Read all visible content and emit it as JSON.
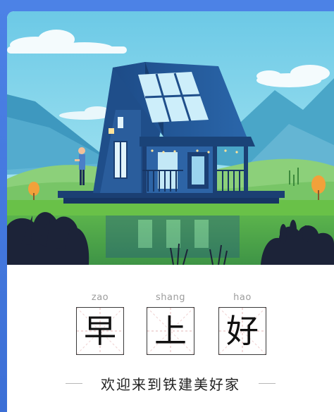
{
  "palette": {
    "frame": "#3c6fd6",
    "sky": "#7fd3e8",
    "mountain": "#4aa6c8",
    "grass": "#69c148",
    "house": "#1f4e8a"
  },
  "illustration": {
    "icon": "house-landscape-illustration"
  },
  "greeting_card": {
    "characters": [
      {
        "pinyin": "zao",
        "hanzi": "早"
      },
      {
        "pinyin": "shang",
        "hanzi": "上"
      },
      {
        "pinyin": "hao",
        "hanzi": "好"
      }
    ],
    "message": "欢迎来到铁建美好家"
  }
}
